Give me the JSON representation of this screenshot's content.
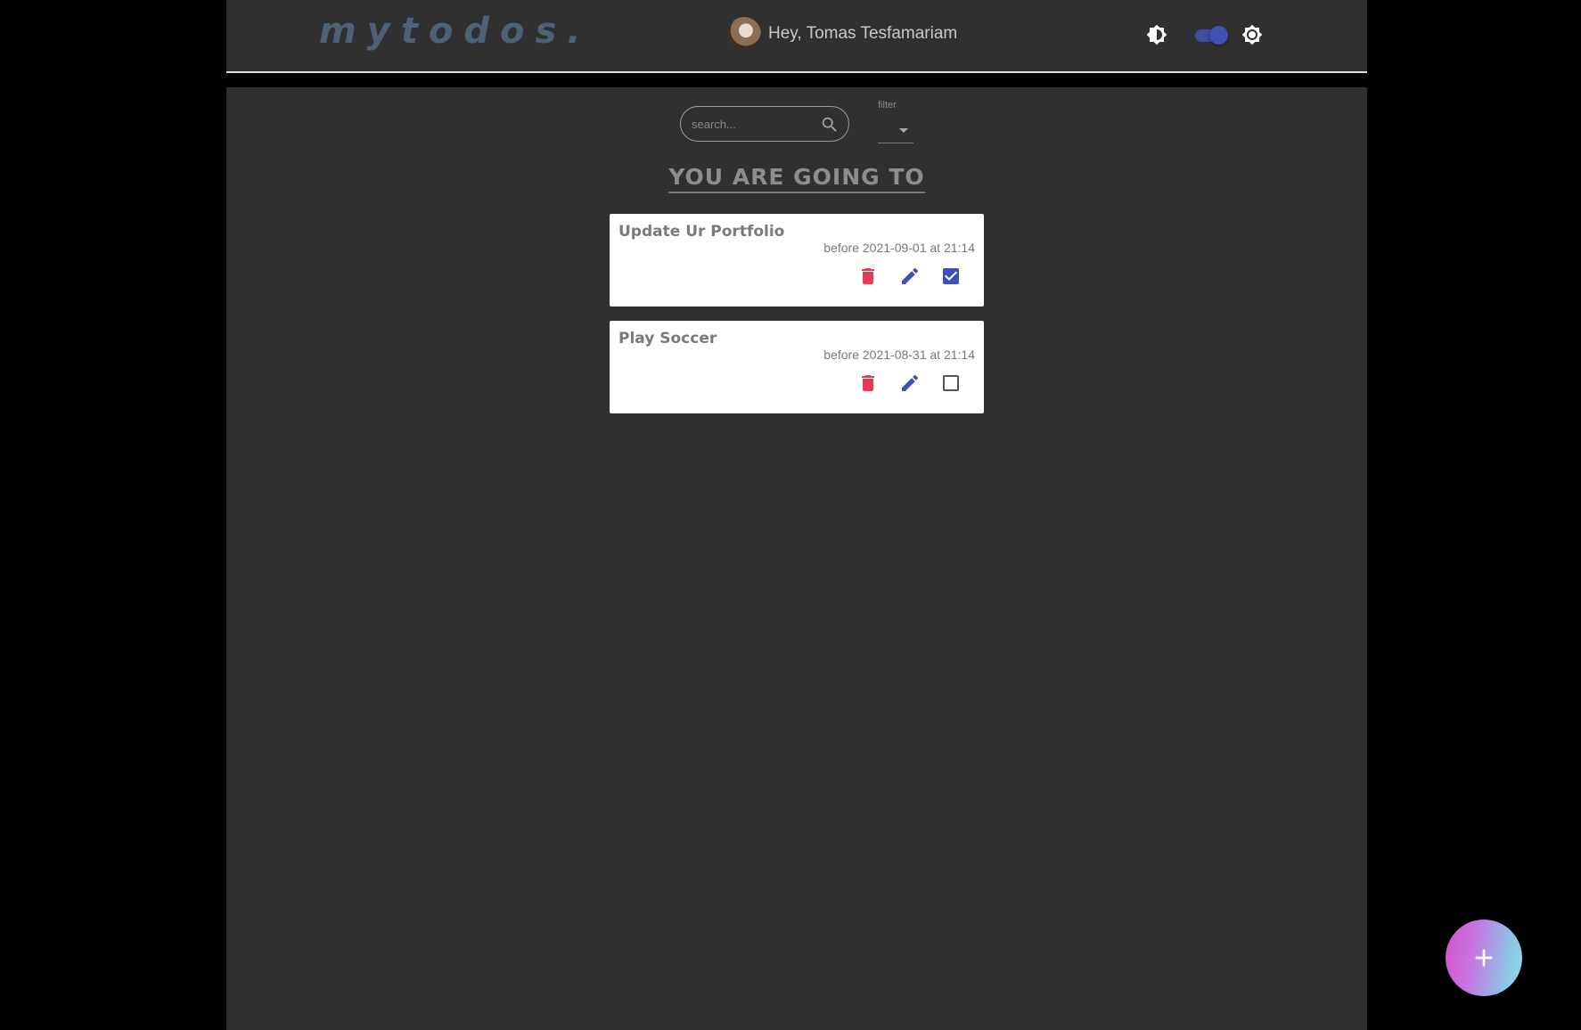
{
  "header": {
    "logo": "mytodos.",
    "greeting": "Hey, Tomas Tesfamariam"
  },
  "colors": {
    "accent": "#3f51b5",
    "delete": "#e53955",
    "background": "#303030"
  },
  "search": {
    "placeholder": "search..."
  },
  "filter": {
    "label": "filter",
    "value": ""
  },
  "heading": "YOU ARE GOING TO",
  "todos": [
    {
      "title": "Update Ur Portfolio",
      "due": "before 2021-09-01 at 21:14",
      "done": true
    },
    {
      "title": "Play Soccer",
      "due": "before 2021-08-31 at 21:14",
      "done": false
    }
  ],
  "icons": {
    "theme_contrast": "contrast-icon",
    "theme_brightness": "brightness-icon",
    "search": "search-icon",
    "delete": "trash-icon",
    "edit": "pencil-icon",
    "checkbox": "checkbox-icon",
    "add": "plus-icon"
  }
}
